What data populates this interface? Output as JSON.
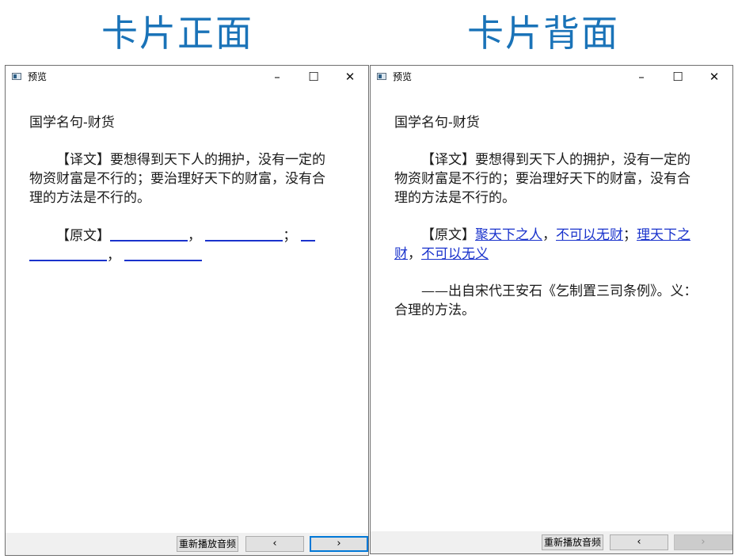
{
  "front": {
    "heading": "卡片正面",
    "window_title": "预览",
    "content_title": "国学名句-财货",
    "translation": "【译文】要想得到天下人的拥护，没有一定的物资财富是不行的；要治理好天下的财富，没有合理的方法是不行的。",
    "original_label": "【原文】",
    "punct": {
      "comma1": "，",
      "semicolon": "；",
      "comma2": "，"
    },
    "buttons": {
      "replay": "重新播放音频",
      "prev": "‹",
      "next": "›"
    }
  },
  "back": {
    "heading": "卡片背面",
    "window_title": "预览",
    "content_title": "国学名句-财货",
    "translation": "【译文】要想得到天下人的拥护，没有一定的物资财富是不行的；要治理好天下的财富，没有合理的方法是不行的。",
    "original_label": "【原文】",
    "answers": [
      "聚天下之人",
      "不可以无财",
      "理天下之财",
      "不可以无义"
    ],
    "punct": {
      "comma1": "，",
      "semicolon": "；",
      "comma2": "，"
    },
    "source": "——出自宋代王安石《乞制置三司条例》。义：合理的方法。",
    "buttons": {
      "replay": "重新播放音频",
      "prev": "‹",
      "next": "›"
    }
  },
  "window_controls": {
    "minimize": "–",
    "maximize": "☐",
    "close": "✕"
  }
}
